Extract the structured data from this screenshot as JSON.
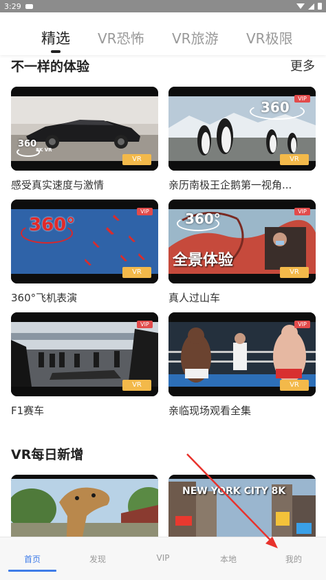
{
  "status_bar": {
    "time": "3:29"
  },
  "top_tabs": [
    {
      "label": "精选"
    },
    {
      "label": "VR恐怖"
    },
    {
      "label": "VR旅游"
    },
    {
      "label": "VR极限"
    }
  ],
  "section_featured": {
    "title": "不一样的体验",
    "more": "更多"
  },
  "cards": [
    {
      "title": "感受真实速度与激情",
      "badge": "VR",
      "overlay": "360",
      "overlay_sub": "8K VR"
    },
    {
      "title": "亲历南极王企鹅第一视角...",
      "badge": "VR",
      "vip": "VIP",
      "overlay": "360"
    },
    {
      "title": "360°飞机表演",
      "badge": "VR",
      "vip": "VIP",
      "overlay": "360°"
    },
    {
      "title": "真人过山车",
      "badge": "VR",
      "vip": "VIP",
      "overlay": "360°",
      "overlay_caption": "全景体验"
    },
    {
      "title": "F1赛车",
      "badge": "VR",
      "vip": "VIP"
    },
    {
      "title": "亲临现场观看全集",
      "badge": "VR",
      "vip": "VIP"
    }
  ],
  "section_daily": {
    "title": "VR每日新增"
  },
  "daily_cards": [
    {
      "caption": ""
    },
    {
      "caption": "NEW YORK CITY 8K"
    }
  ],
  "bottom_nav": [
    {
      "label": "首页"
    },
    {
      "label": "发现"
    },
    {
      "label": "VIP"
    },
    {
      "label": "本地"
    },
    {
      "label": "我的"
    }
  ],
  "colors": {
    "accent": "#3f7ce8",
    "vr_badge": "#f3b94a",
    "vip_badge": "#e24b4b",
    "annotation_arrow": "#e8322c"
  }
}
